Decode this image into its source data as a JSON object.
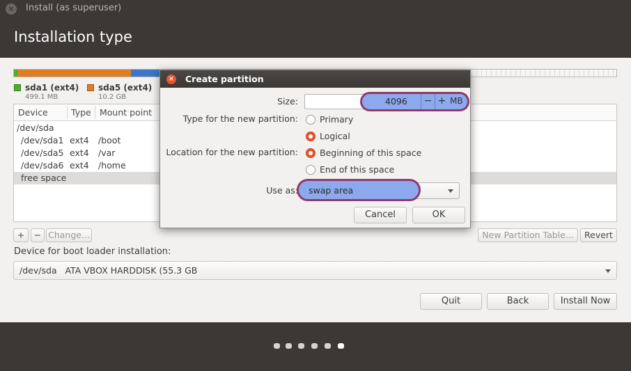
{
  "window": {
    "title": "Install (as superuser)",
    "close_glyph": "×"
  },
  "page": {
    "title": "Installation type"
  },
  "partition_bar": {
    "legend": [
      {
        "name": "sda1 (ext4)",
        "size": "499.1 MB",
        "color": "#4eae2c"
      },
      {
        "name": "sda5 (ext4)",
        "size": "10.2 GB",
        "color": "#e07c21"
      }
    ]
  },
  "table": {
    "headers": [
      "Device",
      "Type",
      "Mount point"
    ],
    "rows": [
      {
        "device": "/dev/sda",
        "type": "",
        "mount": ""
      },
      {
        "device": "/dev/sda1",
        "type": "ext4",
        "mount": "/boot"
      },
      {
        "device": "/dev/sda5",
        "type": "ext4",
        "mount": "/var"
      },
      {
        "device": "/dev/sda6",
        "type": "ext4",
        "mount": "/home"
      },
      {
        "device": "free space",
        "type": "",
        "mount": ""
      }
    ]
  },
  "table_buttons": {
    "add": "+",
    "remove": "−",
    "change": "Change...",
    "new_table": "New Partition Table...",
    "revert": "Revert"
  },
  "boot_loader": {
    "label": "Device for boot loader installation:",
    "value": "/dev/sda   ATA VBOX HARDDISK (55.3 GB"
  },
  "nav_buttons": {
    "quit": "Quit",
    "back": "Back",
    "install": "Install Now"
  },
  "dialog": {
    "title": "Create partition",
    "size_label": "Size:",
    "size_value": "4096",
    "size_minus": "−",
    "size_plus": "+",
    "size_unit": "MB",
    "type_label": "Type for the new partition:",
    "type_options": [
      "Primary",
      "Logical"
    ],
    "type_selected": "Logical",
    "location_label": "Location for the new partition:",
    "location_options": [
      "Beginning of this space",
      "End of this space"
    ],
    "location_selected": "Beginning of this space",
    "use_as_label": "Use as:",
    "use_as_value": "swap area",
    "cancel": "Cancel",
    "ok": "OK"
  },
  "progress_dots": {
    "total": 6,
    "current": 6
  },
  "colors": {
    "accent": "#e9542c",
    "highlight": "#8da9ee",
    "highlight_border": "#8e3b6a",
    "chrome": "#3b3836"
  }
}
